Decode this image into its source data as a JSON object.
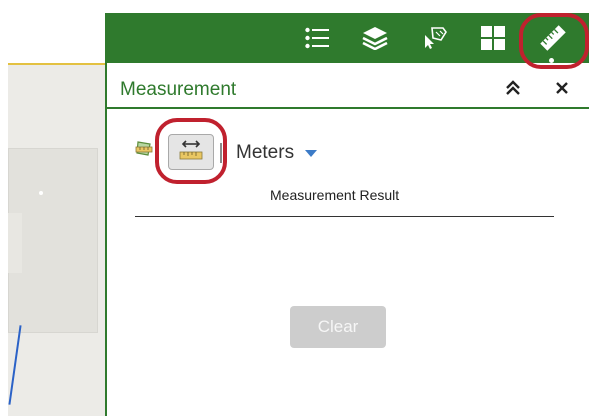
{
  "toolbar": {
    "buttons": [
      {
        "icon": "list-icon"
      },
      {
        "icon": "layers-icon"
      },
      {
        "icon": "select-icon"
      },
      {
        "icon": "grid-icon"
      },
      {
        "icon": "ruler-icon",
        "active": true
      }
    ],
    "color": "#2f7a2d"
  },
  "panel": {
    "title": "Measurement",
    "collapse_icon": "double-chevron-up-icon",
    "close_icon": "close-icon"
  },
  "measurement": {
    "tools": [
      {
        "icon": "area-measure-icon"
      },
      {
        "icon": "distance-measure-icon",
        "selected": true
      }
    ],
    "unit": "Meters",
    "result_label": "Measurement Result",
    "clear_label": "Clear"
  },
  "highlight_color": "#c0212e"
}
